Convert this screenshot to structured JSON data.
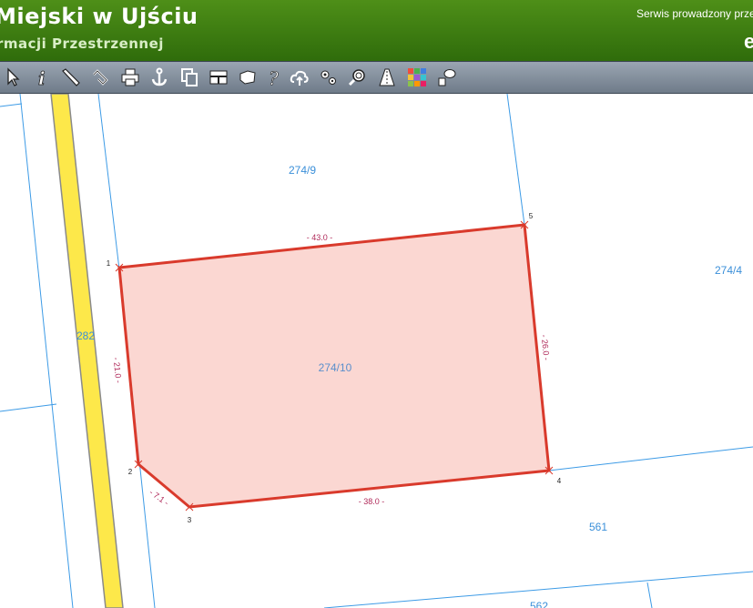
{
  "header": {
    "title": "Miejski w Ujściu",
    "subtitle": "rmacji Przestrzennej",
    "service_text": "Serwis prowadzony prze",
    "corner_text": "e"
  },
  "toolbar": {
    "tools": [
      {
        "name": "select-arrow-icon"
      },
      {
        "name": "info-icon"
      },
      {
        "name": "measure-ruler-icon"
      },
      {
        "name": "link-icon"
      },
      {
        "name": "print-icon"
      },
      {
        "name": "anchor-icon"
      },
      {
        "name": "copy-icon"
      },
      {
        "name": "layout-icon"
      },
      {
        "name": "shape-icon"
      },
      {
        "name": "help-icon"
      },
      {
        "name": "cloud-upload-icon"
      },
      {
        "name": "settings-gears-icon"
      },
      {
        "name": "zoom-icon"
      },
      {
        "name": "road-icon"
      },
      {
        "name": "color-grid-icon"
      },
      {
        "name": "chat-icon"
      }
    ]
  },
  "map": {
    "colors": {
      "parcel_line": "#3d9be6",
      "road_fill": "#fde84a",
      "road_edge": "#8a8a8a",
      "highlight_fill": "#f9c9c3",
      "highlight_stroke": "#d93a2c",
      "vertex_label": "#222222",
      "edge_label": "#b02a5a",
      "parcel_label": "#3a8fd9"
    },
    "parcel_labels": [
      {
        "id": "parcel-274-9",
        "text": "274/9"
      },
      {
        "id": "parcel-274-4",
        "text": "274/4"
      },
      {
        "id": "parcel-274-10",
        "text": "274/10"
      },
      {
        "id": "parcel-282",
        "text": "282"
      },
      {
        "id": "parcel-561",
        "text": "561"
      },
      {
        "id": "parcel-562",
        "text": "562"
      }
    ],
    "vertex_labels": [
      "1",
      "2",
      "3",
      "4",
      "5"
    ],
    "edge_labels": [
      "- 43.0 -",
      "- 26.0 -",
      "- 21.0 -",
      "- 7.1 -",
      "- 38.0 -"
    ]
  }
}
